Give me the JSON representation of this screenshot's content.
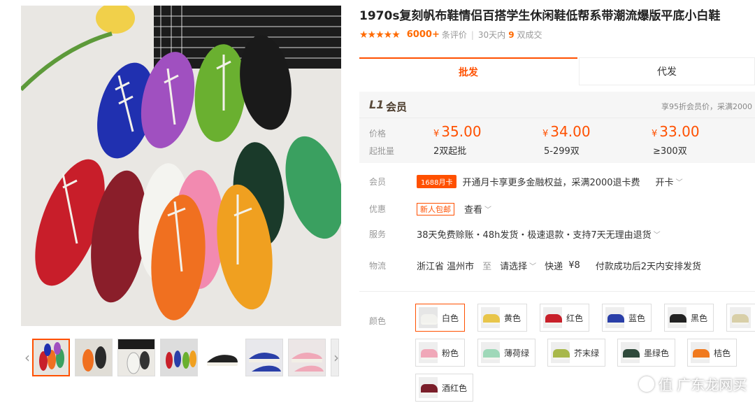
{
  "product": {
    "title": "1970s复刻帆布鞋情侣百搭学生休闲鞋低帮系带潮流爆版平底小白鞋",
    "stars": "★★★★★",
    "rating_count": "6000+",
    "rating_label": "条评价",
    "sold_prefix": "30天内",
    "sold_num": "9",
    "sold_suffix": "双成交"
  },
  "tabs": [
    {
      "label": "批发"
    },
    {
      "label": "代发"
    }
  ],
  "member": {
    "level": "L1",
    "label": "会员",
    "note": "享95折会员价，采满2000"
  },
  "price_table": {
    "price_label": "价格",
    "qty_label": "起批量",
    "tiers": [
      {
        "currency": "¥",
        "price": "35.00",
        "qty": "2双起批"
      },
      {
        "currency": "¥",
        "price": "34.00",
        "qty": "5-299双"
      },
      {
        "currency": "¥",
        "price": "33.00",
        "qty": "≥300双"
      }
    ]
  },
  "rows": {
    "member_row": {
      "label": "会员",
      "badge": "1688月卡",
      "text": "开通月卡享更多金融权益，采满2000退卡费",
      "action": "开卡"
    },
    "promo_row": {
      "label": "优惠",
      "badge": "新人包邮",
      "action": "查看"
    },
    "service_row": {
      "label": "服务",
      "text": "38天免费赊账・48h发货・极速退款・支持7天无理由退货"
    },
    "logistics_row": {
      "label": "物流",
      "origin": "浙江省 温州市",
      "to": "至",
      "dest": "请选择",
      "method": "快递",
      "fee": "¥8",
      "note": "付款成功后2天内安排发货"
    }
  },
  "colors": {
    "label": "颜色",
    "options": [
      {
        "name": "白色",
        "hex": "#f2f2ee"
      },
      {
        "name": "黄色",
        "hex": "#e8c54a"
      },
      {
        "name": "红色",
        "hex": "#c8202a"
      },
      {
        "name": "蓝色",
        "hex": "#2a3fa8"
      },
      {
        "name": "黑色",
        "hex": "#222222"
      },
      {
        "name": "粉色",
        "hex": "#f0a8b8"
      },
      {
        "name": "薄荷绿",
        "hex": "#9fd8b8"
      },
      {
        "name": "芥末绿",
        "hex": "#a8b84a"
      },
      {
        "name": "墨绿色",
        "hex": "#2f4a3a"
      },
      {
        "name": "桔色",
        "hex": "#f07a1e"
      },
      {
        "name": "酒红色",
        "hex": "#7a1e2a"
      }
    ]
  },
  "watermark": {
    "text": "值 广东龙网买"
  },
  "accent": "#ff5000"
}
